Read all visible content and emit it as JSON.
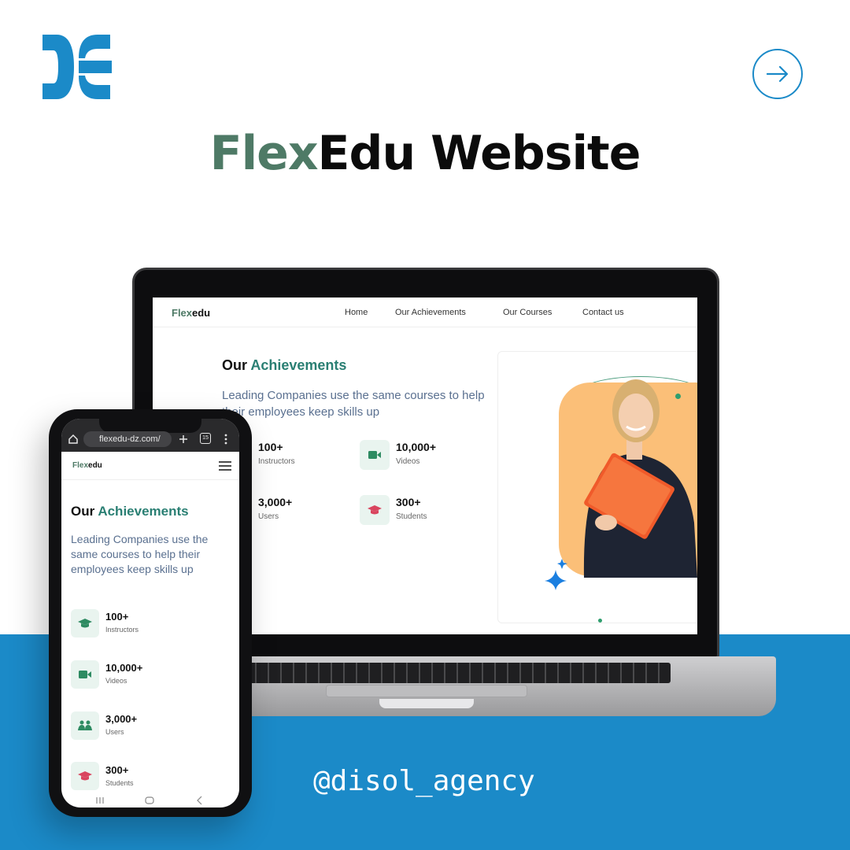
{
  "headline": {
    "accent": "Flex",
    "rest": "Edu Website"
  },
  "handle": "@disol_agency",
  "colors": {
    "brand_blue": "#1b8ac8",
    "accent_green": "#4e7a66",
    "teal": "#2a7f73",
    "icon_green": "#2e8b62",
    "icon_red": "#d9455f"
  },
  "desktop": {
    "logo": {
      "hl": "Flex",
      "rest": "edu"
    },
    "nav": [
      "Home",
      "Our Achievements",
      "Our Courses",
      "Contact us"
    ],
    "title_a": "Our",
    "title_b": "Achievements",
    "subtitle": "Leading Companies use the same courses to help their employees keep skills up",
    "stats": [
      {
        "value": "100+",
        "label": "Instructors",
        "icon": "graduation-cap-icon"
      },
      {
        "value": "10,000+",
        "label": "Videos",
        "icon": "video-icon"
      },
      {
        "value": "3,000+",
        "label": "Users",
        "icon": "users-icon"
      },
      {
        "value": "300+",
        "label": "Students",
        "icon": "graduation-cap-icon"
      }
    ]
  },
  "mobile": {
    "url": "flexedu-dz.com/",
    "tab_count": "15",
    "logo": {
      "hl": "Flex",
      "rest": "edu"
    },
    "title_a": "Our",
    "title_b": "Achievements",
    "subtitle": "Leading Companies use the same courses to help their employees keep skills up",
    "stats": [
      {
        "value": "100+",
        "label": "Instructors",
        "icon": "graduation-cap-icon"
      },
      {
        "value": "10,000+",
        "label": "Videos",
        "icon": "video-icon"
      },
      {
        "value": "3,000+",
        "label": "Users",
        "icon": "users-icon"
      },
      {
        "value": "300+",
        "label": "Students",
        "icon": "graduation-cap-icon"
      }
    ]
  }
}
